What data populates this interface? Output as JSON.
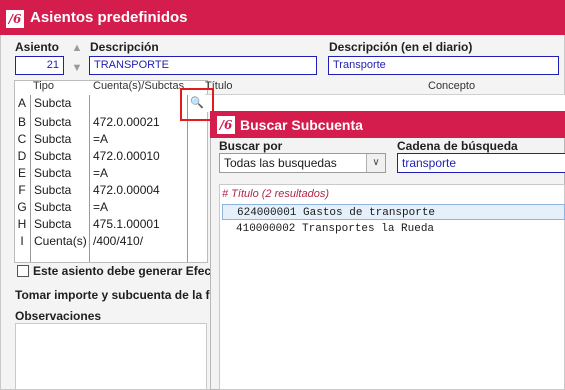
{
  "app": {
    "logo_text": "/6",
    "window_title": "Asientos predefinidos"
  },
  "header": {
    "asiento_label": "Asiento",
    "asiento_value": "21",
    "descripcion_label": "Descripción",
    "descripcion_value": "TRANSPORTE",
    "descripcion_diario_label": "Descripción (en el diario)",
    "descripcion_diario_value": "Transporte"
  },
  "grid": {
    "columns": [
      "Tipo",
      "Cuenta(s)/Subctas",
      "Título",
      "Concepto"
    ],
    "rows": [
      {
        "letter": "A",
        "tipo": "Subcta",
        "cuenta": ""
      },
      {
        "letter": "B",
        "tipo": "Subcta",
        "cuenta": "472.0.00021"
      },
      {
        "letter": "C",
        "tipo": "Subcta",
        "cuenta": "=A"
      },
      {
        "letter": "D",
        "tipo": "Subcta",
        "cuenta": "472.0.00010"
      },
      {
        "letter": "E",
        "tipo": "Subcta",
        "cuenta": "=A"
      },
      {
        "letter": "F",
        "tipo": "Subcta",
        "cuenta": "472.0.00004"
      },
      {
        "letter": "G",
        "tipo": "Subcta",
        "cuenta": "=A"
      },
      {
        "letter": "H",
        "tipo": "Subcta",
        "cuenta": "475.1.00001"
      },
      {
        "letter": "I",
        "tipo": "Cuenta(s)",
        "cuenta": "/400/410/"
      }
    ]
  },
  "footer": {
    "checkbox_label": "Este asiento debe generar Efect",
    "importe_text": "Tomar importe y subcuenta de la f",
    "observaciones_label": "Observaciones"
  },
  "popup": {
    "logo_text": "/6",
    "title": "Buscar Subcuenta",
    "buscar_por_label": "Buscar por",
    "buscar_por_value": "Todas las busquedas",
    "cadena_label": "Cadena de búsqueda",
    "cadena_value": "transporte",
    "results_header": "# Título       (2 resultados)",
    "results": [
      {
        "text": "624000001 Gastos de transporte",
        "selected": true
      },
      {
        "text": "410000002 Transportes la Rueda",
        "selected": false
      }
    ]
  },
  "colors": {
    "brand": "#d41d4d",
    "field_text": "#1f1fb5",
    "highlight_box": "#e21b1b"
  }
}
